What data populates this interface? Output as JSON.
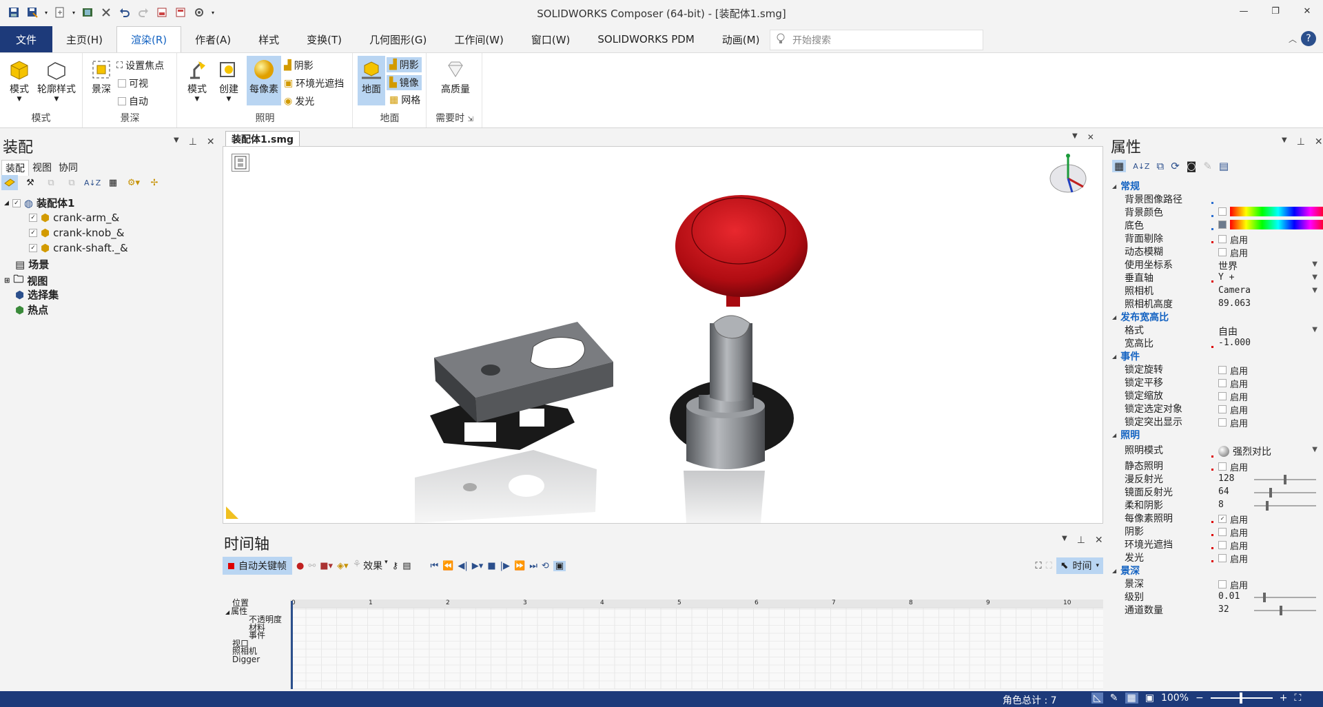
{
  "window": {
    "title": "SOLIDWORKS Composer (64-bit) - [装配体1.smg]",
    "minimize": "—",
    "restore": "❐",
    "close": "✕"
  },
  "menu": {
    "items": [
      "文件",
      "主页(H)",
      "渲染(R)",
      "作者(A)",
      "样式",
      "变换(T)",
      "几何图形(G)",
      "工作间(W)",
      "窗口(W)",
      "SOLIDWORKS PDM",
      "动画(M)"
    ],
    "active": "渲染(R)",
    "search_placeholder": "开始搜索"
  },
  "ribbon": {
    "mode_group": {
      "label": "模式",
      "btn_mode": "模式",
      "btn_outline": "轮廓样式"
    },
    "dof_group": {
      "label": "景深",
      "btn_dof": "景深",
      "set_focus": "设置焦点",
      "visible": "可视",
      "auto": "自动"
    },
    "lighting_group": {
      "label": "照明",
      "btn_mode": "模式",
      "btn_create": "创建",
      "btn_perpixel": "每像素",
      "shadow": "阴影",
      "ao": "环境光遮挡",
      "glow": "发光"
    },
    "ground_group": {
      "label": "地面",
      "btn_ground": "地面",
      "shadow": "阴影",
      "mirror": "镜像",
      "grid": "网格"
    },
    "quality_group": {
      "label": "需要时",
      "btn_quality": "高质量"
    }
  },
  "left_panel": {
    "title": "装配",
    "tabs": [
      "装配",
      "视图",
      "协同"
    ],
    "tree": {
      "root": "装配体1",
      "children": [
        "crank-arm_&",
        "crank-knob_&",
        "crank-shaft._&"
      ],
      "scene": "场景",
      "views": "视图",
      "selection_sets": "选择集",
      "hotspots": "热点"
    }
  },
  "document": {
    "tab": "装配体1.smg"
  },
  "timeline": {
    "title": "时间轴",
    "auto_key": "自动关键帧",
    "effects": "效果",
    "time_mode": "时间",
    "ruler": [
      "0",
      "1",
      "2",
      "3",
      "4",
      "5",
      "6",
      "7",
      "8",
      "9",
      "10"
    ],
    "tracks": [
      "位置",
      "属性",
      "不透明度",
      "材料",
      "事件",
      "视口",
      "照相机",
      "Digger"
    ]
  },
  "right_panel": {
    "title": "属性",
    "sections": {
      "general": {
        "label": "常规",
        "bg_image_path": "背景图像路径",
        "bg_color": "背景颜色",
        "base_color": "底色",
        "backface_cull": "背面剔除",
        "motion_blur": "动态模糊",
        "coord_sys": "使用坐标系",
        "coord_sys_val": "世界",
        "vertical_axis": "垂直轴",
        "vertical_axis_val": "Y +",
        "camera": "照相机",
        "camera_val": "Camera",
        "camera_height": "照相机高度",
        "camera_height_val": "89.063"
      },
      "aspect": {
        "label": "发布宽高比",
        "format": "格式",
        "format_val": "自由",
        "ratio": "宽高比",
        "ratio_val": "-1.000"
      },
      "events": {
        "label": "事件",
        "lock_rotate": "锁定旋转",
        "lock_pan": "锁定平移",
        "lock_zoom": "锁定缩放",
        "lock_select": "锁定选定对象",
        "lock_highlight": "锁定突出显示"
      },
      "lighting": {
        "label": "照明",
        "mode": "照明模式",
        "mode_val": "强烈对比",
        "static": "静态照明",
        "diffuse": "漫反射光",
        "diffuse_val": "128",
        "specular": "镜面反射光",
        "specular_val": "64",
        "soft_shadow": "柔和阴影",
        "soft_shadow_val": "8",
        "per_pixel": "每像素照明",
        "shadow": "阴影",
        "ao": "环境光遮挡",
        "glow": "发光"
      },
      "dof": {
        "label": "景深",
        "dof": "景深",
        "level": "级别",
        "level_val": "0.01",
        "passes": "通道数量",
        "passes_val": "32"
      }
    },
    "enable": "启用",
    "sliders": {
      "diffuse": 0.5,
      "specular": 0.25,
      "soft_shadow": 0.2,
      "level": 0.15,
      "passes": 0.43
    }
  },
  "status": {
    "actor_count": "角色总计 : 7",
    "zoom": "100%",
    "minus": "−",
    "plus": "+"
  },
  "colors": {
    "accent": "#1463c2",
    "file_bg": "#1d3a7a",
    "knob": "#c8101a",
    "part": "#6d6f72"
  }
}
